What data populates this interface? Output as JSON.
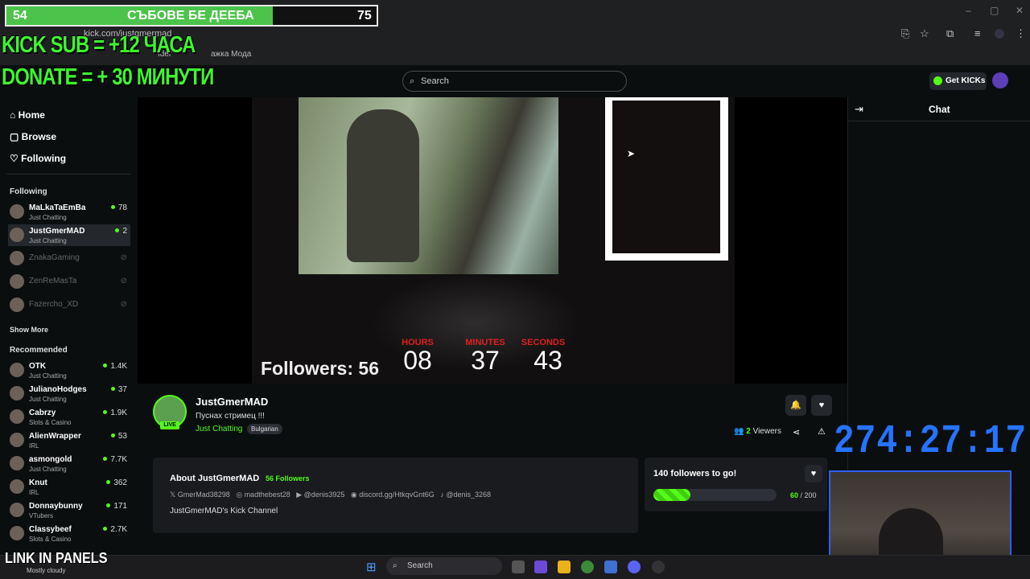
{
  "browser": {
    "url": "kick.com/justgmermad",
    "bookmarks": [
      "Ider",
      "ажка Мода"
    ],
    "minimize": "–",
    "maximize": "▢",
    "close": "✕"
  },
  "overlays": {
    "goal_left": "54",
    "goal_title": "СЪБОВЕ БЕ ДЕЕБА",
    "goal_right": "75",
    "goal_progress": 0.72,
    "line1": "KICK SUB = +12 ЧАСА",
    "line2": "DONATE = + 30 МИНУТИ",
    "countdown": "274:27:17",
    "link_panels": "LINK IN PANELS"
  },
  "header": {
    "search_placeholder": "Search",
    "get_kicks": "Get KICKs"
  },
  "sidebar": {
    "nav": [
      {
        "label": "Home"
      },
      {
        "label": "Browse"
      },
      {
        "label": "Following"
      }
    ],
    "following_title": "Following",
    "following": [
      {
        "name": "MaLkaTaEmBa",
        "category": "Just Chatting",
        "viewers": "78",
        "live": true
      },
      {
        "name": "JustGmerMAD",
        "category": "Just Chatting",
        "viewers": "2",
        "live": true
      },
      {
        "name": "ZnakaGaming",
        "category": "",
        "viewers": "",
        "live": false
      },
      {
        "name": "ZenReMasTa",
        "category": "",
        "viewers": "",
        "live": false
      },
      {
        "name": "Fazercho_XD",
        "category": "",
        "viewers": "",
        "live": false
      }
    ],
    "show_more": "Show More",
    "recommended_title": "Recommended",
    "recommended": [
      {
        "name": "OTK",
        "category": "Just Chatting",
        "viewers": "1.4K"
      },
      {
        "name": "JulianoHodges",
        "category": "Just Chatting",
        "viewers": "37"
      },
      {
        "name": "Cabrzy",
        "category": "Slots & Casino",
        "viewers": "1.9K"
      },
      {
        "name": "AlienWrapper",
        "category": "IRL",
        "viewers": "53"
      },
      {
        "name": "asmongold",
        "category": "Just Chatting",
        "viewers": "7.7K"
      },
      {
        "name": "Knut",
        "category": "IRL",
        "viewers": "362"
      },
      {
        "name": "Donnaybunny",
        "category": "VTubers",
        "viewers": "171"
      },
      {
        "name": "Classybeef",
        "category": "Slots & Casino",
        "viewers": "2.7K"
      }
    ]
  },
  "player": {
    "followers_text": "Followers: 56",
    "timer": {
      "hours_label": "HOURS",
      "minutes_label": "MINUTES",
      "seconds_label": "SECONDS",
      "hours": "08",
      "minutes": "37",
      "seconds": "43"
    }
  },
  "channel": {
    "name": "JustGmerMAD",
    "title": "Пуснах стримец !!!",
    "category": "Just Chatting",
    "tag": "Bulgarian",
    "live_label": "LIVE",
    "viewers_count": "2",
    "viewers_label": "Viewers"
  },
  "about": {
    "title": "About JustGmerMAD",
    "followers": "56 Followers",
    "socials": [
      "GmerMad38298",
      "madthebest28",
      "@denis3925",
      "discord.gg/HtkqvGnt6G",
      "@denis_3268"
    ],
    "description": "JustGmerMAD's Kick Channel"
  },
  "goal": {
    "title": "140 followers to go!",
    "current": "60",
    "target": "200",
    "progress": 0.3
  },
  "chat": {
    "title": "Chat"
  },
  "taskbar": {
    "search": "Search",
    "weather": "Mostly cloudy"
  },
  "colors": {
    "kick_green": "#53fc18",
    "timer_blue": "#2673ff",
    "overlay_green": "#3ff531",
    "timer_red": "#e02020"
  }
}
